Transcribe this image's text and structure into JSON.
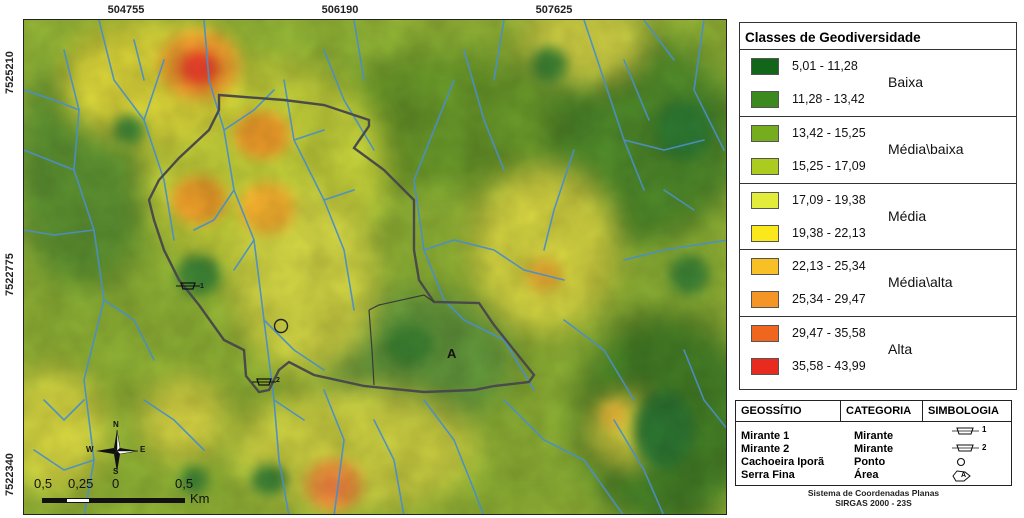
{
  "map": {
    "top_coords": [
      "504755",
      "506190",
      "507625"
    ],
    "left_coords": [
      "7525210",
      "7522775",
      "7522340"
    ],
    "area_label": "A",
    "mirante_1_marker": "1",
    "mirante_2_marker": "2"
  },
  "legend": {
    "title": "Classes de Geodiversidade",
    "groups": [
      {
        "name": "Baixa",
        "classes": [
          {
            "range": "5,01 - 11,28",
            "color": "#11661a"
          },
          {
            "range": "11,28 - 13,42",
            "color": "#3a8a20"
          }
        ]
      },
      {
        "name": "Média\\baixa",
        "classes": [
          {
            "range": "13,42 - 15,25",
            "color": "#75ad1e"
          },
          {
            "range": "15,25 - 17,09",
            "color": "#abcb1f"
          }
        ]
      },
      {
        "name": "Média",
        "classes": [
          {
            "range": "17,09 - 19,38",
            "color": "#e3ec3a"
          },
          {
            "range": "19,38 - 22,13",
            "color": "#fbe81a"
          }
        ]
      },
      {
        "name": "Média\\alta",
        "classes": [
          {
            "range": "22,13 - 25,34",
            "color": "#f8c025"
          },
          {
            "range": "25,34 - 29,47",
            "color": "#f59525"
          }
        ]
      },
      {
        "name": "Alta",
        "classes": [
          {
            "range": "29,47 - 35,58",
            "color": "#f0661f"
          },
          {
            "range": "35,58 - 43,99",
            "color": "#e92a1f"
          }
        ]
      }
    ]
  },
  "geosites": {
    "headers": [
      "GEOSSÍTIO",
      "CATEGORIA",
      "SIMBOLOGIA"
    ],
    "rows": [
      {
        "name": "Mirante 1",
        "category": "Mirante",
        "symbol_label": "1"
      },
      {
        "name": "Mirante 2",
        "category": "Mirante",
        "symbol_label": "2"
      },
      {
        "name": "Cachoeira Iporã",
        "category": "Ponto",
        "symbol_label": ""
      },
      {
        "name": "Serra Fina",
        "category": "Área",
        "symbol_label": "A"
      }
    ]
  },
  "coordinate_system": {
    "line1": "Sistema de Coordenadas Planas",
    "line2": "SIRGAS 2000 - 23S"
  },
  "scale_bar": {
    "labels": [
      "0,5",
      "0,25",
      "0",
      "0,5"
    ],
    "unit": "Km"
  },
  "north_arrow": {
    "n": "N",
    "s": "S",
    "e": "E",
    "w": "W"
  }
}
